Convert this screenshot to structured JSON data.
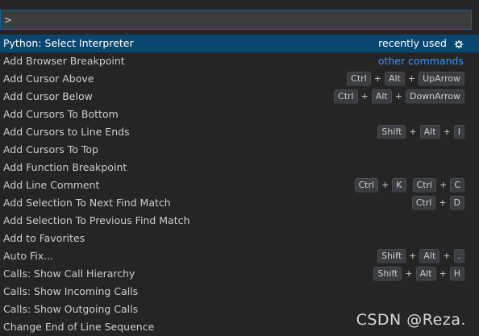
{
  "input": {
    "value": ">"
  },
  "selected": {
    "label": "Python: Select Interpreter",
    "recently_used": "recently used",
    "icon": "gear-icon"
  },
  "items": [
    {
      "label": "Add Browser Breakpoint",
      "right_text": "other commands"
    },
    {
      "label": "Add Cursor Above",
      "chords": [
        [
          "Ctrl",
          "Alt",
          "UpArrow"
        ]
      ]
    },
    {
      "label": "Add Cursor Below",
      "chords": [
        [
          "Ctrl",
          "Alt",
          "DownArrow"
        ]
      ]
    },
    {
      "label": "Add Cursors To Bottom"
    },
    {
      "label": "Add Cursors to Line Ends",
      "chords": [
        [
          "Shift",
          "Alt",
          "I"
        ]
      ]
    },
    {
      "label": "Add Cursors To Top"
    },
    {
      "label": "Add Function Breakpoint"
    },
    {
      "label": "Add Line Comment",
      "chords": [
        [
          "Ctrl",
          "K"
        ],
        [
          "Ctrl",
          "C"
        ]
      ]
    },
    {
      "label": "Add Selection To Next Find Match",
      "chords": [
        [
          "Ctrl",
          "D"
        ]
      ]
    },
    {
      "label": "Add Selection To Previous Find Match"
    },
    {
      "label": "Add to Favorites"
    },
    {
      "label": "Auto Fix...",
      "chords": [
        [
          "Shift",
          "Alt",
          "."
        ]
      ]
    },
    {
      "label": "Calls: Show Call Hierarchy",
      "chords": [
        [
          "Shift",
          "Alt",
          "H"
        ]
      ]
    },
    {
      "label": "Calls: Show Incoming Calls"
    },
    {
      "label": "Calls: Show Outgoing Calls"
    },
    {
      "label": "Change End of Line Sequence"
    }
  ],
  "watermark": "CSDN @Reza.",
  "colors": {
    "background": "#252526",
    "selection": "#094771",
    "link": "#3794ff",
    "input_border": "#0e639c"
  }
}
